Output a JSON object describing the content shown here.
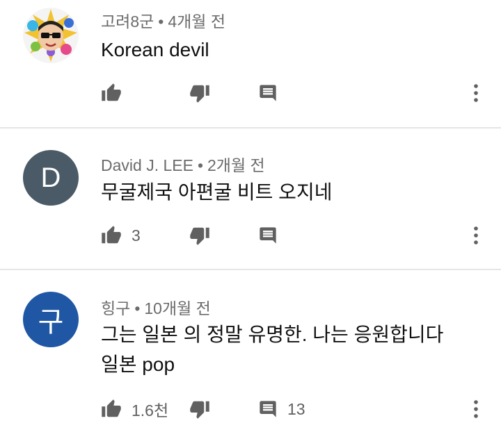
{
  "comments": [
    {
      "author": "고려8군",
      "time": "4개월 전",
      "text": "Korean devil",
      "avatar_letter": "",
      "avatar_color": "#ffffff",
      "likes": "",
      "replies": ""
    },
    {
      "author": "David J. LEE",
      "time": "2개월 전",
      "text": "무굴제국 아편굴 비트 오지네",
      "avatar_letter": "D",
      "avatar_color": "#4a5a66",
      "likes": "3",
      "replies": ""
    },
    {
      "author": "힝구",
      "time": "10개월 전",
      "text": "그는 일본 의 정말 유명한. 나는 응원합니다 일본 pop",
      "avatar_letter": "구",
      "avatar_color": "#1f57a4",
      "likes": "1.6천",
      "replies": "13"
    }
  ],
  "separator": "•",
  "icons": {
    "like": "thumbs-up-icon",
    "dislike": "thumbs-down-icon",
    "reply": "reply-comment-icon",
    "more": "more-vertical-icon"
  },
  "colors": {
    "icon": "#606060",
    "meta_text": "#6b6b6b",
    "body_text": "#0f0f0f",
    "divider": "#e5e5e5"
  }
}
